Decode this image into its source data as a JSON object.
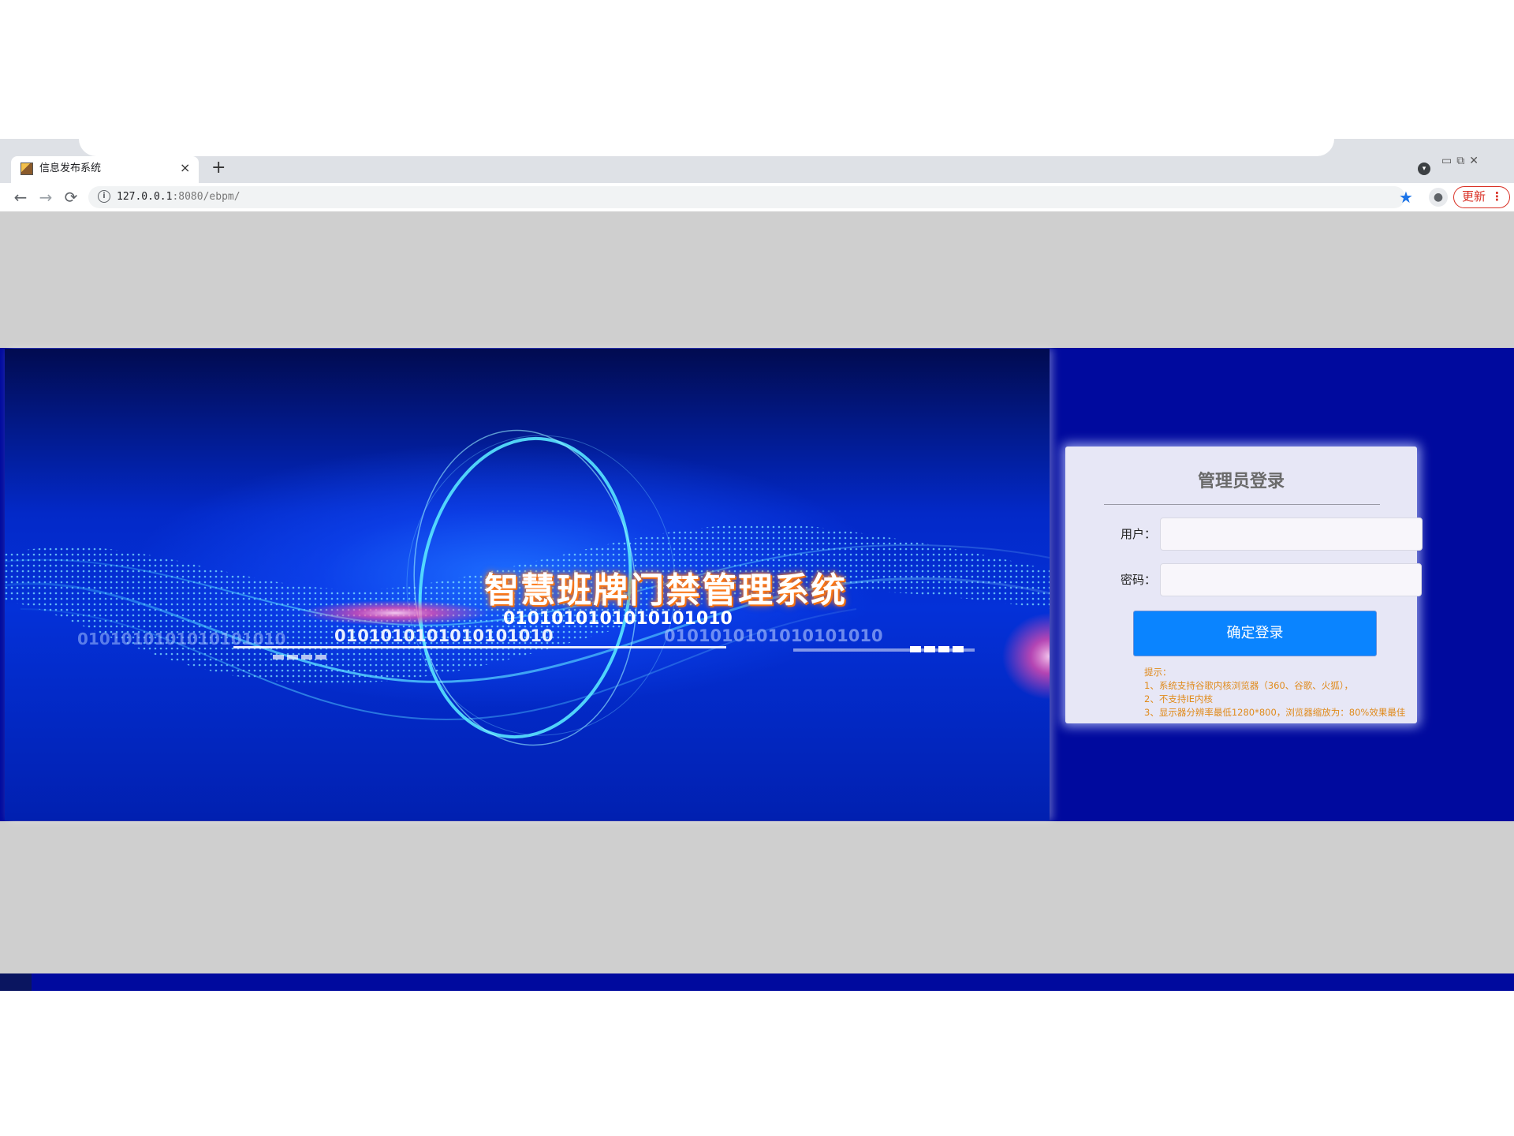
{
  "browser": {
    "tab_title": "信息发布系统",
    "tab_close": "×",
    "new_tab": "+",
    "url_host": "127.0.0.1",
    "url_rest": ":8080/ebpm/",
    "update_label": "更新",
    "update_menu": "⋮",
    "nav": {
      "back": "←",
      "forward": "→",
      "reload": "⟳"
    },
    "icons": [
      "favicon-icon",
      "close-icon",
      "plus-icon",
      "back-arrow-icon",
      "forward-arrow-icon",
      "reload-icon",
      "info-icon",
      "star-icon",
      "profile-icon",
      "kebab-menu-icon"
    ]
  },
  "hero": {
    "title": "智慧班牌门禁管理系统",
    "binary_1": "0101010101010101010",
    "binary_2": "0101010101010101010",
    "binary_3": "0101010101010101010",
    "binary_4": "0101010101010101010"
  },
  "login": {
    "title": "管理员登录",
    "user_label": "用户：",
    "password_label": "密码：",
    "user_value": "",
    "password_value": "",
    "submit_label": "确定登录",
    "tips": [
      "提示：",
      "1、系统支持谷歌内核浏览器（360、谷歌、火狐），",
      "2、不支持IE内核",
      "3、显示器分辨率最低1280*800，浏览器缩放为：80%效果最佳"
    ]
  },
  "colors": {
    "banner_blue": "#000a9e",
    "button_blue": "#0a84ff",
    "tip_orange": "#e08a1a",
    "update_red": "#d93025",
    "page_gray": "#cfcfcf"
  }
}
